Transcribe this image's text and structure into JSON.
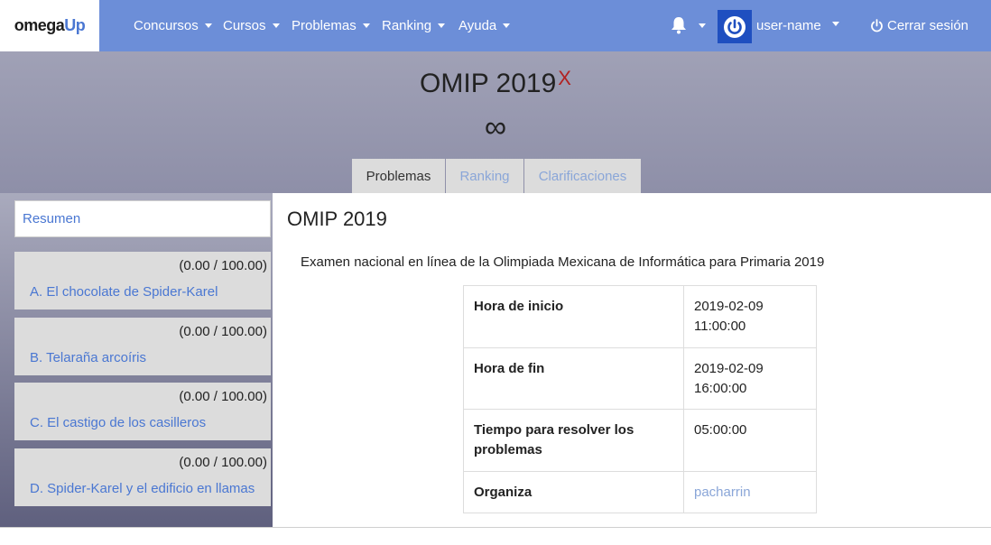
{
  "brand": {
    "part1": "omega",
    "part2": "Up"
  },
  "nav": {
    "items": [
      {
        "label": "Concursos"
      },
      {
        "label": "Cursos"
      },
      {
        "label": "Problemas"
      },
      {
        "label": "Ranking"
      },
      {
        "label": "Ayuda"
      }
    ],
    "username": "user-name",
    "logout": "Cerrar sesión",
    "icons": {
      "bell": "bell-icon",
      "avatar": "power-icon",
      "logout": "power-icon"
    }
  },
  "contest": {
    "title": "OMIP 2019",
    "title_mark": "X",
    "time_symbol": "∞",
    "tabs": [
      {
        "label": "Problemas",
        "active": true
      },
      {
        "label": "Ranking",
        "active": false
      },
      {
        "label": "Clarificaciones",
        "active": false
      }
    ]
  },
  "sidebar": {
    "summary": "Resumen",
    "problems": [
      {
        "score": "(0.00 / 100.00)",
        "name": "A. El chocolate de Spider-Karel"
      },
      {
        "score": "(0.00 / 100.00)",
        "name": "B. Telaraña arcoíris"
      },
      {
        "score": "(0.00 / 100.00)",
        "name": "C. El castigo de los casilleros"
      },
      {
        "score": "(0.00 / 100.00)",
        "name": "D. Spider-Karel y el edificio en llamas"
      }
    ]
  },
  "main": {
    "title": "OMIP 2019",
    "description": "Examen nacional en línea de la Olimpiada Mexicana de Informática para Primaria 2019",
    "table": [
      {
        "key": "Hora de inicio",
        "value_line1": "2019-02-09",
        "value_line2": "11:00:00"
      },
      {
        "key": "Hora de fin",
        "value_line1": "2019-02-09",
        "value_line2": "16:00:00"
      },
      {
        "key": "Tiempo para resolver los problemas",
        "value_line1": "05:00:00",
        "value_line2": ""
      },
      {
        "key": "Organiza",
        "value_line1": "pacharrin",
        "value_line2": ""
      }
    ]
  },
  "colors": {
    "navbar": "#6c8ed8",
    "link": "#4a77d2",
    "accent_x": "#b22222"
  }
}
